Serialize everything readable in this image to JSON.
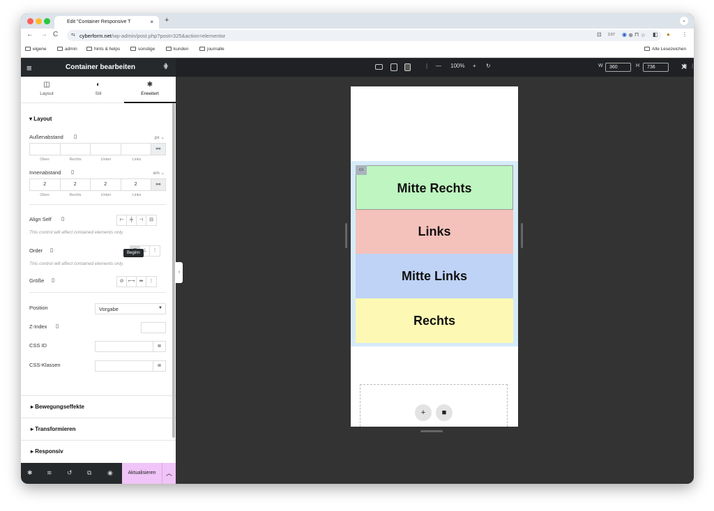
{
  "browser": {
    "tab_title": "Edit \"Container Responsive T",
    "tab_close": "×",
    "new_tab": "+",
    "tab_menu": "⌄",
    "url_host": "cyberform.net",
    "url_path": "/wp-admin/post.php?post=325&action=elementor",
    "toolbar_badge": "2.57",
    "bookmarks": [
      "eigene",
      "admin",
      "hints & helps",
      "sonstige",
      "kunden",
      "journalle"
    ],
    "all_bookmarks": "Alle Lesezeichen"
  },
  "panel": {
    "title": "Container bearbeiten",
    "tabs": [
      {
        "label": "Layout",
        "icon": "layout-icon"
      },
      {
        "label": "Stil",
        "icon": "style-icon"
      },
      {
        "label": "Erweitert",
        "icon": "gear-icon"
      }
    ],
    "section_layout": "Layout",
    "margin": {
      "label": "Außenabstand",
      "unit": "px",
      "values": [
        "",
        "",
        "",
        ""
      ],
      "sublabels": [
        "Oben",
        "Rechts",
        "Unten",
        "Links"
      ]
    },
    "padding": {
      "label": "Innenabstand",
      "unit": "em",
      "values": [
        "2",
        "2",
        "2",
        "2"
      ],
      "sublabels": [
        "Oben",
        "Rechts",
        "Unten",
        "Links"
      ]
    },
    "align_self": "Align Self",
    "align_note": "This control will affect contained elements only.",
    "tooltip": "Beginn",
    "order": "Order",
    "order_note": "This control will affect contained elements only.",
    "size": "Größe",
    "position": {
      "label": "Position",
      "value": "Vorgabe"
    },
    "z_index": {
      "label": "Z-Index",
      "value": ""
    },
    "css_id": {
      "label": "CSS ID",
      "value": ""
    },
    "css_classes": {
      "label": "CSS-Klassen",
      "value": ""
    },
    "accordions": [
      "Bewegungseffekte",
      "Transformieren",
      "Responsiv"
    ],
    "update_button": "Aktualisieren"
  },
  "canvas": {
    "zoom": "100%",
    "width_label": "W",
    "width_value": "360",
    "height_label": "H",
    "height_value": "736",
    "boxes": [
      "Mitte Rechts",
      "Links",
      "Mitte Links",
      "Rechts"
    ],
    "colors": {
      "green": "#bef5c0",
      "red": "#f5c1bb",
      "blue": "#bfd3f6",
      "yellow": "#fdf9b4"
    }
  }
}
